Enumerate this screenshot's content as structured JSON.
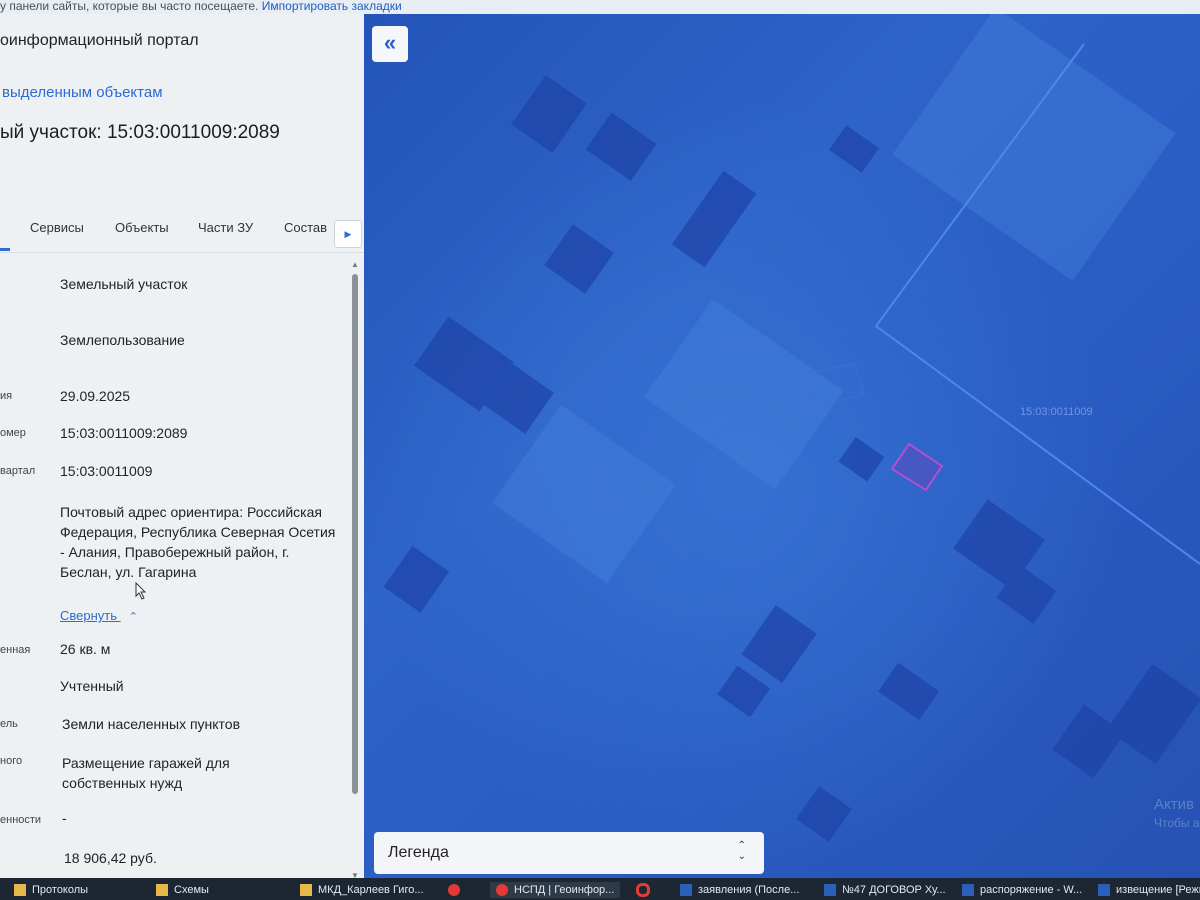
{
  "browser": {
    "bookmarks_hint": "у панели сайты, которые вы часто посещаете.",
    "import_bookmarks": "Импортировать закладки"
  },
  "panel": {
    "portal_title": "оинформационный портал",
    "to_selected": "выделенным объектам",
    "object_title": "ый участок: 15:03:0011009:2089",
    "tabs": [
      "Сервисы",
      "Объекты",
      "Части ЗУ",
      "Состав"
    ],
    "properties": [
      {
        "label": "",
        "value": "Земельный участок"
      },
      {
        "label": "",
        "value": "Землепользование"
      },
      {
        "label": "ия",
        "value": "29.09.2025"
      },
      {
        "label": "омер",
        "value": "15:03:0011009:2089"
      },
      {
        "label": "вартал",
        "value": "15:03:0011009"
      },
      {
        "label": "",
        "value": "Почтовый адрес ориентира: Российская Федерация, Республика Северная Осетия - Алания, Правобережный район, г. Беслан, ул. Гагарина"
      },
      {
        "label": "енная",
        "value": "26 кв. м"
      },
      {
        "label": "",
        "value": "Учтенный"
      },
      {
        "label": "ель",
        "value": "Земли населенных пунктов"
      },
      {
        "label": "ного",
        "value": "Размещение гаражей для собственных нужд"
      },
      {
        "label": "енности",
        "value": "-"
      },
      {
        "label": "",
        "value": "18 906,42 руб."
      }
    ],
    "collapse_label": "Свернуть"
  },
  "map": {
    "collapse_symbol": "«",
    "quarter_label": "15:03:0011009",
    "legend_label": "Легенда",
    "activation_line1": "Актив",
    "activation_line2": "Чтобы а",
    "selected_parcel_color": "#a44fc0",
    "boundary_color": "#4f86ee"
  },
  "taskbar": {
    "items": [
      {
        "label": "Протоколы",
        "icon": "folder-icon"
      },
      {
        "label": "Схемы",
        "icon": "folder-icon"
      },
      {
        "label": "МКД_Карлеев Гиго...",
        "icon": "folder-icon"
      },
      {
        "label": "",
        "icon": "yandex-icon"
      },
      {
        "label": "НСПД | Геоинфор...",
        "icon": "browser-icon"
      },
      {
        "label": "",
        "icon": "opera-icon"
      },
      {
        "label": "заявления (После...",
        "icon": "word-icon"
      },
      {
        "label": "№47 ДОГОВОР Ху...",
        "icon": "word-icon"
      },
      {
        "label": "распоряжение - W...",
        "icon": "word-icon"
      },
      {
        "label": "извещение [Режи...",
        "icon": "word-icon"
      }
    ]
  }
}
